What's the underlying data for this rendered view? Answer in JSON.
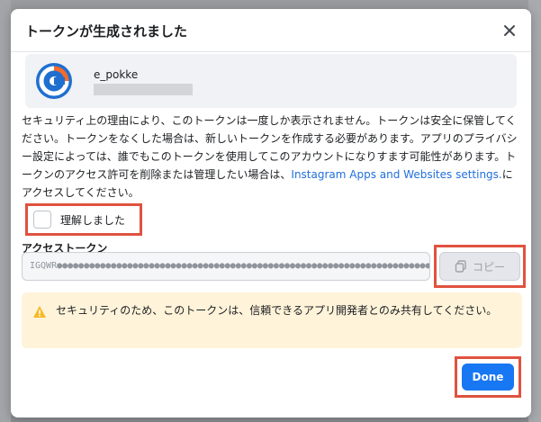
{
  "dialog": {
    "title": "トークンが生成されました"
  },
  "account": {
    "name": "e_pokke"
  },
  "notice": {
    "text": "セキュリティ上の理由により、このトークンは一度しか表示されません。トークンは安全に保管してください。トークンをなくした場合は、新しいトークンを作成する必要があります。アプリのプライバシー設定によっては、誰でもこのトークンを使用してこのアカウントになりすます可能性があります。トークンのアクセス許可を削除または管理したい場合は、",
    "link": "Instagram Apps and Websites settings.",
    "suffix": "にアクセスしてください。"
  },
  "confirm": {
    "label": "理解しました",
    "checked": false
  },
  "token": {
    "label": "アクセストークン",
    "value": "IGQWR●●●●●●●●●●●●●●●●●●●●●●●●●●●●●●●●●●●●●●●●●●●●●●●●●●●●●●●●●●●●●●●●●●●●●●●●●●●●●●●●●●●●●●●●●●●●●●●●●●●●●●●●",
    "copy_label": "コピー"
  },
  "warning": {
    "text": "セキュリティのため、このトークンは、信頼できるアプリ開発者とのみ共有してください。"
  },
  "actions": {
    "done_label": "Done"
  },
  "colors": {
    "primary": "#1877f2",
    "highlight": "#e0523f",
    "warning_bg": "#fff3d9",
    "link": "#216fdb"
  }
}
